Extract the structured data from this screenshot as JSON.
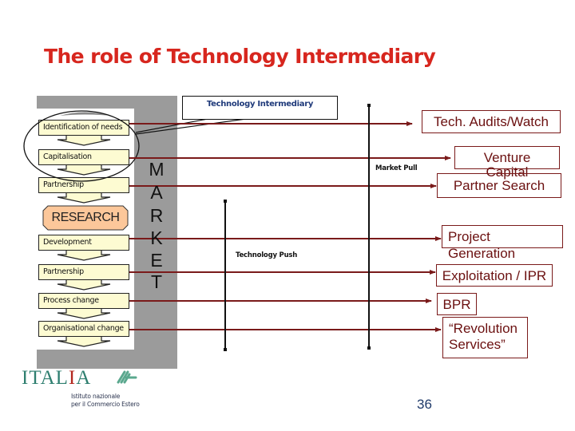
{
  "slide": {
    "title": "The role of Technology Intermediary",
    "page_number": "36"
  },
  "process_steps": [
    {
      "label": "Identification of needs",
      "type": "step"
    },
    {
      "label": "Capitalisation",
      "type": "step"
    },
    {
      "label": "Partnership",
      "type": "step"
    },
    {
      "label": "RESEARCH",
      "type": "highlight"
    },
    {
      "label": "Development",
      "type": "step"
    },
    {
      "label": "Partnership",
      "type": "step"
    },
    {
      "label": "Process change",
      "type": "step"
    },
    {
      "label": "Organisational change",
      "type": "step"
    }
  ],
  "market_column": {
    "letters": [
      "M",
      "A",
      "R",
      "K",
      "E",
      "T"
    ]
  },
  "intermediary_callout": {
    "label": "Technology Intermediary"
  },
  "axes": {
    "market_pull": "Market Pull",
    "technology_push": "Technology Push"
  },
  "services": [
    {
      "from_step": "Identification of needs",
      "lines": [
        "Tech. Audits/Watch"
      ]
    },
    {
      "from_step": "Capitalisation",
      "lines": [
        "Venture",
        "Capital"
      ]
    },
    {
      "from_step": "Partnership",
      "lines": [
        "Partner Search"
      ]
    },
    {
      "from_step": "Development",
      "lines": [
        "Project",
        "Generation"
      ]
    },
    {
      "from_step": "Partnership",
      "lines": [
        "Exploitation / IPR"
      ]
    },
    {
      "from_step": "Process change",
      "lines": [
        "BPR"
      ]
    },
    {
      "from_step": "Organisational change",
      "lines": [
        "“Revolution",
        "Services”"
      ]
    }
  ],
  "logo": {
    "wordmark_prefix": "ITAL",
    "wordmark_red_letter": "I",
    "wordmark_suffix": "A",
    "institute_line1": "Istituto nazionale",
    "institute_line2": "per il Commercio Estero"
  },
  "colors": {
    "title": "#d7261e",
    "arrows": "#7a1a1a",
    "service_text": "#6b1010",
    "step_fill": "#fdfbd2",
    "research_fill": "#fcc79a",
    "panel_gray": "#9b9b9b",
    "intermediary_text": "#1f3a7a"
  }
}
